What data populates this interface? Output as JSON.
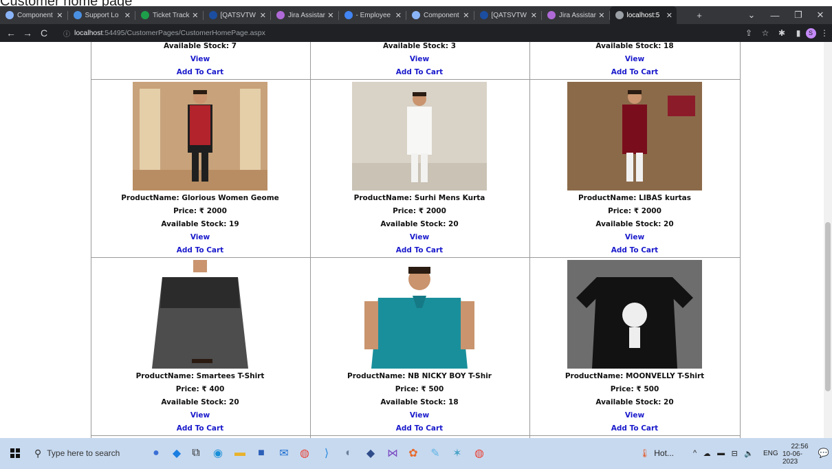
{
  "caption": "Customer home page",
  "browser": {
    "tabs": [
      {
        "label": "Component",
        "color": "#8ab4f8"
      },
      {
        "label": "Support Lo",
        "color": "#4a90e2"
      },
      {
        "label": "Ticket Track",
        "color": "#1e9e4a"
      },
      {
        "label": "[QATSVTW",
        "color": "#1b4ea0"
      },
      {
        "label": "Jira Assistar",
        "color": "#b06ad8"
      },
      {
        "label": "- Employee",
        "color": "#4285f4"
      },
      {
        "label": "Component",
        "color": "#8ab4f8"
      },
      {
        "label": "[QATSVTW",
        "color": "#1b4ea0"
      },
      {
        "label": "Jira Assistar",
        "color": "#b06ad8"
      },
      {
        "label": "localhost:5",
        "color": "#9aa0a6"
      }
    ],
    "url_host": "localhost",
    "url_rest": ":54495/CustomerPages/CustomerHomePage.aspx",
    "profile_initial": "S"
  },
  "top_row": [
    {
      "stock": "Available Stock: 7",
      "view": "View",
      "cart": "Add To Cart"
    },
    {
      "stock": "Available Stock: 3",
      "view": "View",
      "cart": "Add To Cart"
    },
    {
      "stock": "Available Stock: 18",
      "view": "View",
      "cart": "Add To Cart"
    }
  ],
  "rows": [
    [
      {
        "name": "ProductName: Glorious Women Geome",
        "price": "Price: ₹ 2000",
        "stock": "Available Stock: 19",
        "view": "View",
        "cart": "Add To Cart",
        "img": "kurta-red-jacket"
      },
      {
        "name": "ProductName: Surhi Mens Kurta",
        "price": "Price: ₹ 2000",
        "stock": "Available Stock: 20",
        "view": "View",
        "cart": "Add To Cart",
        "img": "kurta-white"
      },
      {
        "name": "ProductName: LIBAS kurtas",
        "price": "Price: ₹ 2000",
        "stock": "Available Stock: 20",
        "view": "View",
        "cart": "Add To Cart",
        "img": "kurta-maroon"
      }
    ],
    [
      {
        "name": "ProductName: Smartees  T-Shirt",
        "price": "Price: ₹ 400",
        "stock": "Available Stock: 20",
        "view": "View",
        "cart": "Add To Cart",
        "img": "tshirt-grey"
      },
      {
        "name": "ProductName: NB NICKY BOY  T-Shir",
        "price": "Price: ₹ 500",
        "stock": "Available Stock: 18",
        "view": "View",
        "cart": "Add To Cart",
        "img": "polo-teal"
      },
      {
        "name": "ProductName: MOONVELLY  T-Shirt",
        "price": "Price: ₹ 500",
        "stock": "Available Stock: 20",
        "view": "View",
        "cart": "Add To Cart",
        "img": "tshirt-black"
      }
    ]
  ],
  "taskbar": {
    "search_placeholder": "Type here to search",
    "weather": "Hot...",
    "lang": "ENG",
    "time": "22:56",
    "date": "10-06-2023",
    "notif_count": "3"
  }
}
